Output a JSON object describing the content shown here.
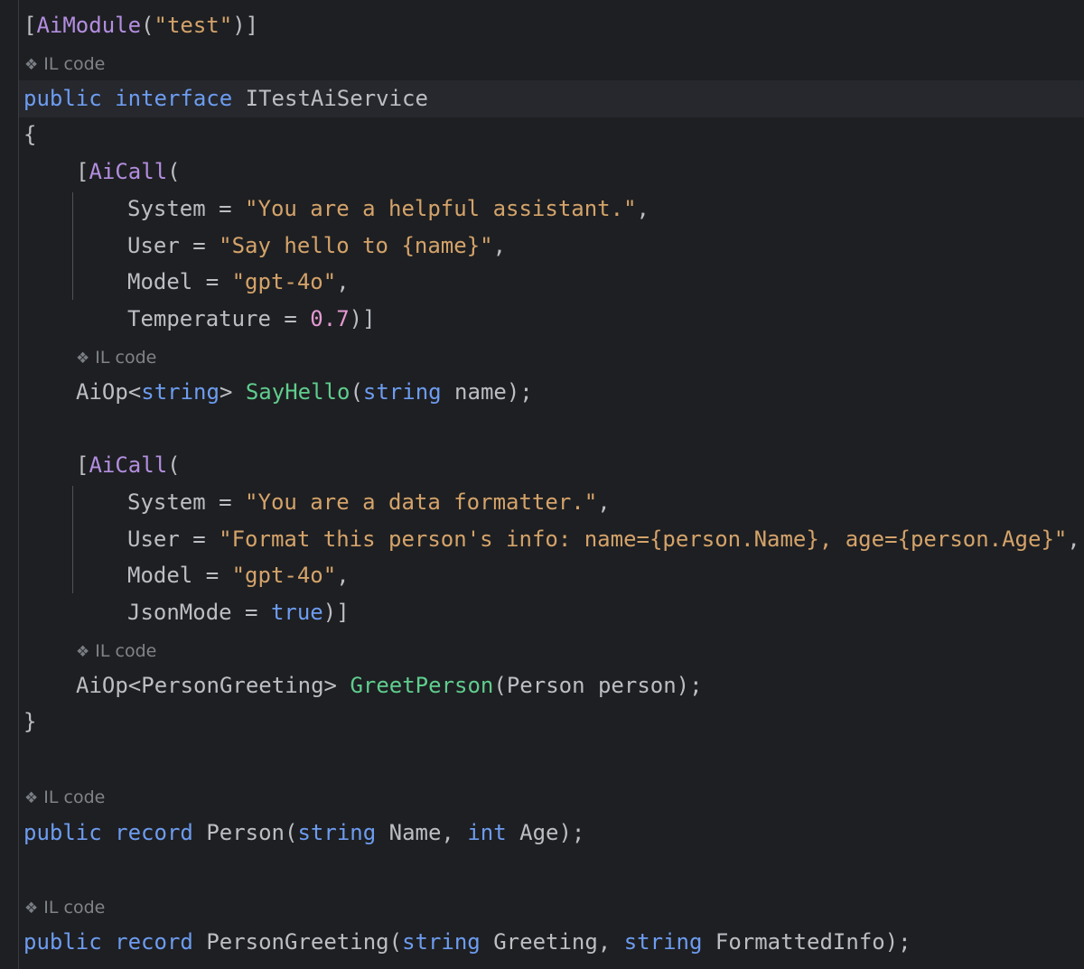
{
  "code": {
    "l_module_open": "[",
    "l_module_attr": "AiModule",
    "l_module_paren": "(",
    "l_module_arg": "\"test\"",
    "l_module_close": ")]",
    "il_hint_label": "IL code",
    "kw_public": "public",
    "kw_interface": "interface",
    "iface_name": "ITestAiService",
    "brace_open": "{",
    "brace_close": "}",
    "aicall_open": "[",
    "aicall_attr": "AiCall",
    "aicall_paren": "(",
    "call1": {
      "system_key": "System = ",
      "system_val": "\"You are a helpful assistant.\"",
      "user_key": "User = ",
      "user_val": "\"Say hello to {name}\"",
      "model_key": "Model = ",
      "model_val": "\"gpt-4o\"",
      "temp_key": "Temperature = ",
      "temp_val": "0.7",
      "temp_close": ")]"
    },
    "method1": {
      "ret_prefix": "AiOp<",
      "ret_type": "string",
      "ret_suffix": "> ",
      "name": "SayHello",
      "paren_open": "(",
      "param_type": "string",
      "param_rest": " name);"
    },
    "call2": {
      "system_key": "System = ",
      "system_val": "\"You are a data formatter.\"",
      "user_key": "User = ",
      "user_val": "\"Format this person's info: name={person.Name}, age={person.Age}\"",
      "model_key": "Model = ",
      "model_val": "\"gpt-4o\"",
      "json_key": "JsonMode = ",
      "json_val": "true",
      "json_close": ")]"
    },
    "method2": {
      "ret": "AiOp<PersonGreeting> ",
      "name": "GreetPerson",
      "params": "(Person person);"
    },
    "kw_record": "record",
    "rec1": {
      "name": "Person(",
      "type1": "string",
      "p1": " Name, ",
      "type2": "int",
      "p2": " Age);"
    },
    "rec2": {
      "name": "PersonGreeting(",
      "type1": "string",
      "p1": " Greeting, ",
      "type2": "string",
      "p2": " FormattedInfo);"
    },
    "comma": ","
  }
}
